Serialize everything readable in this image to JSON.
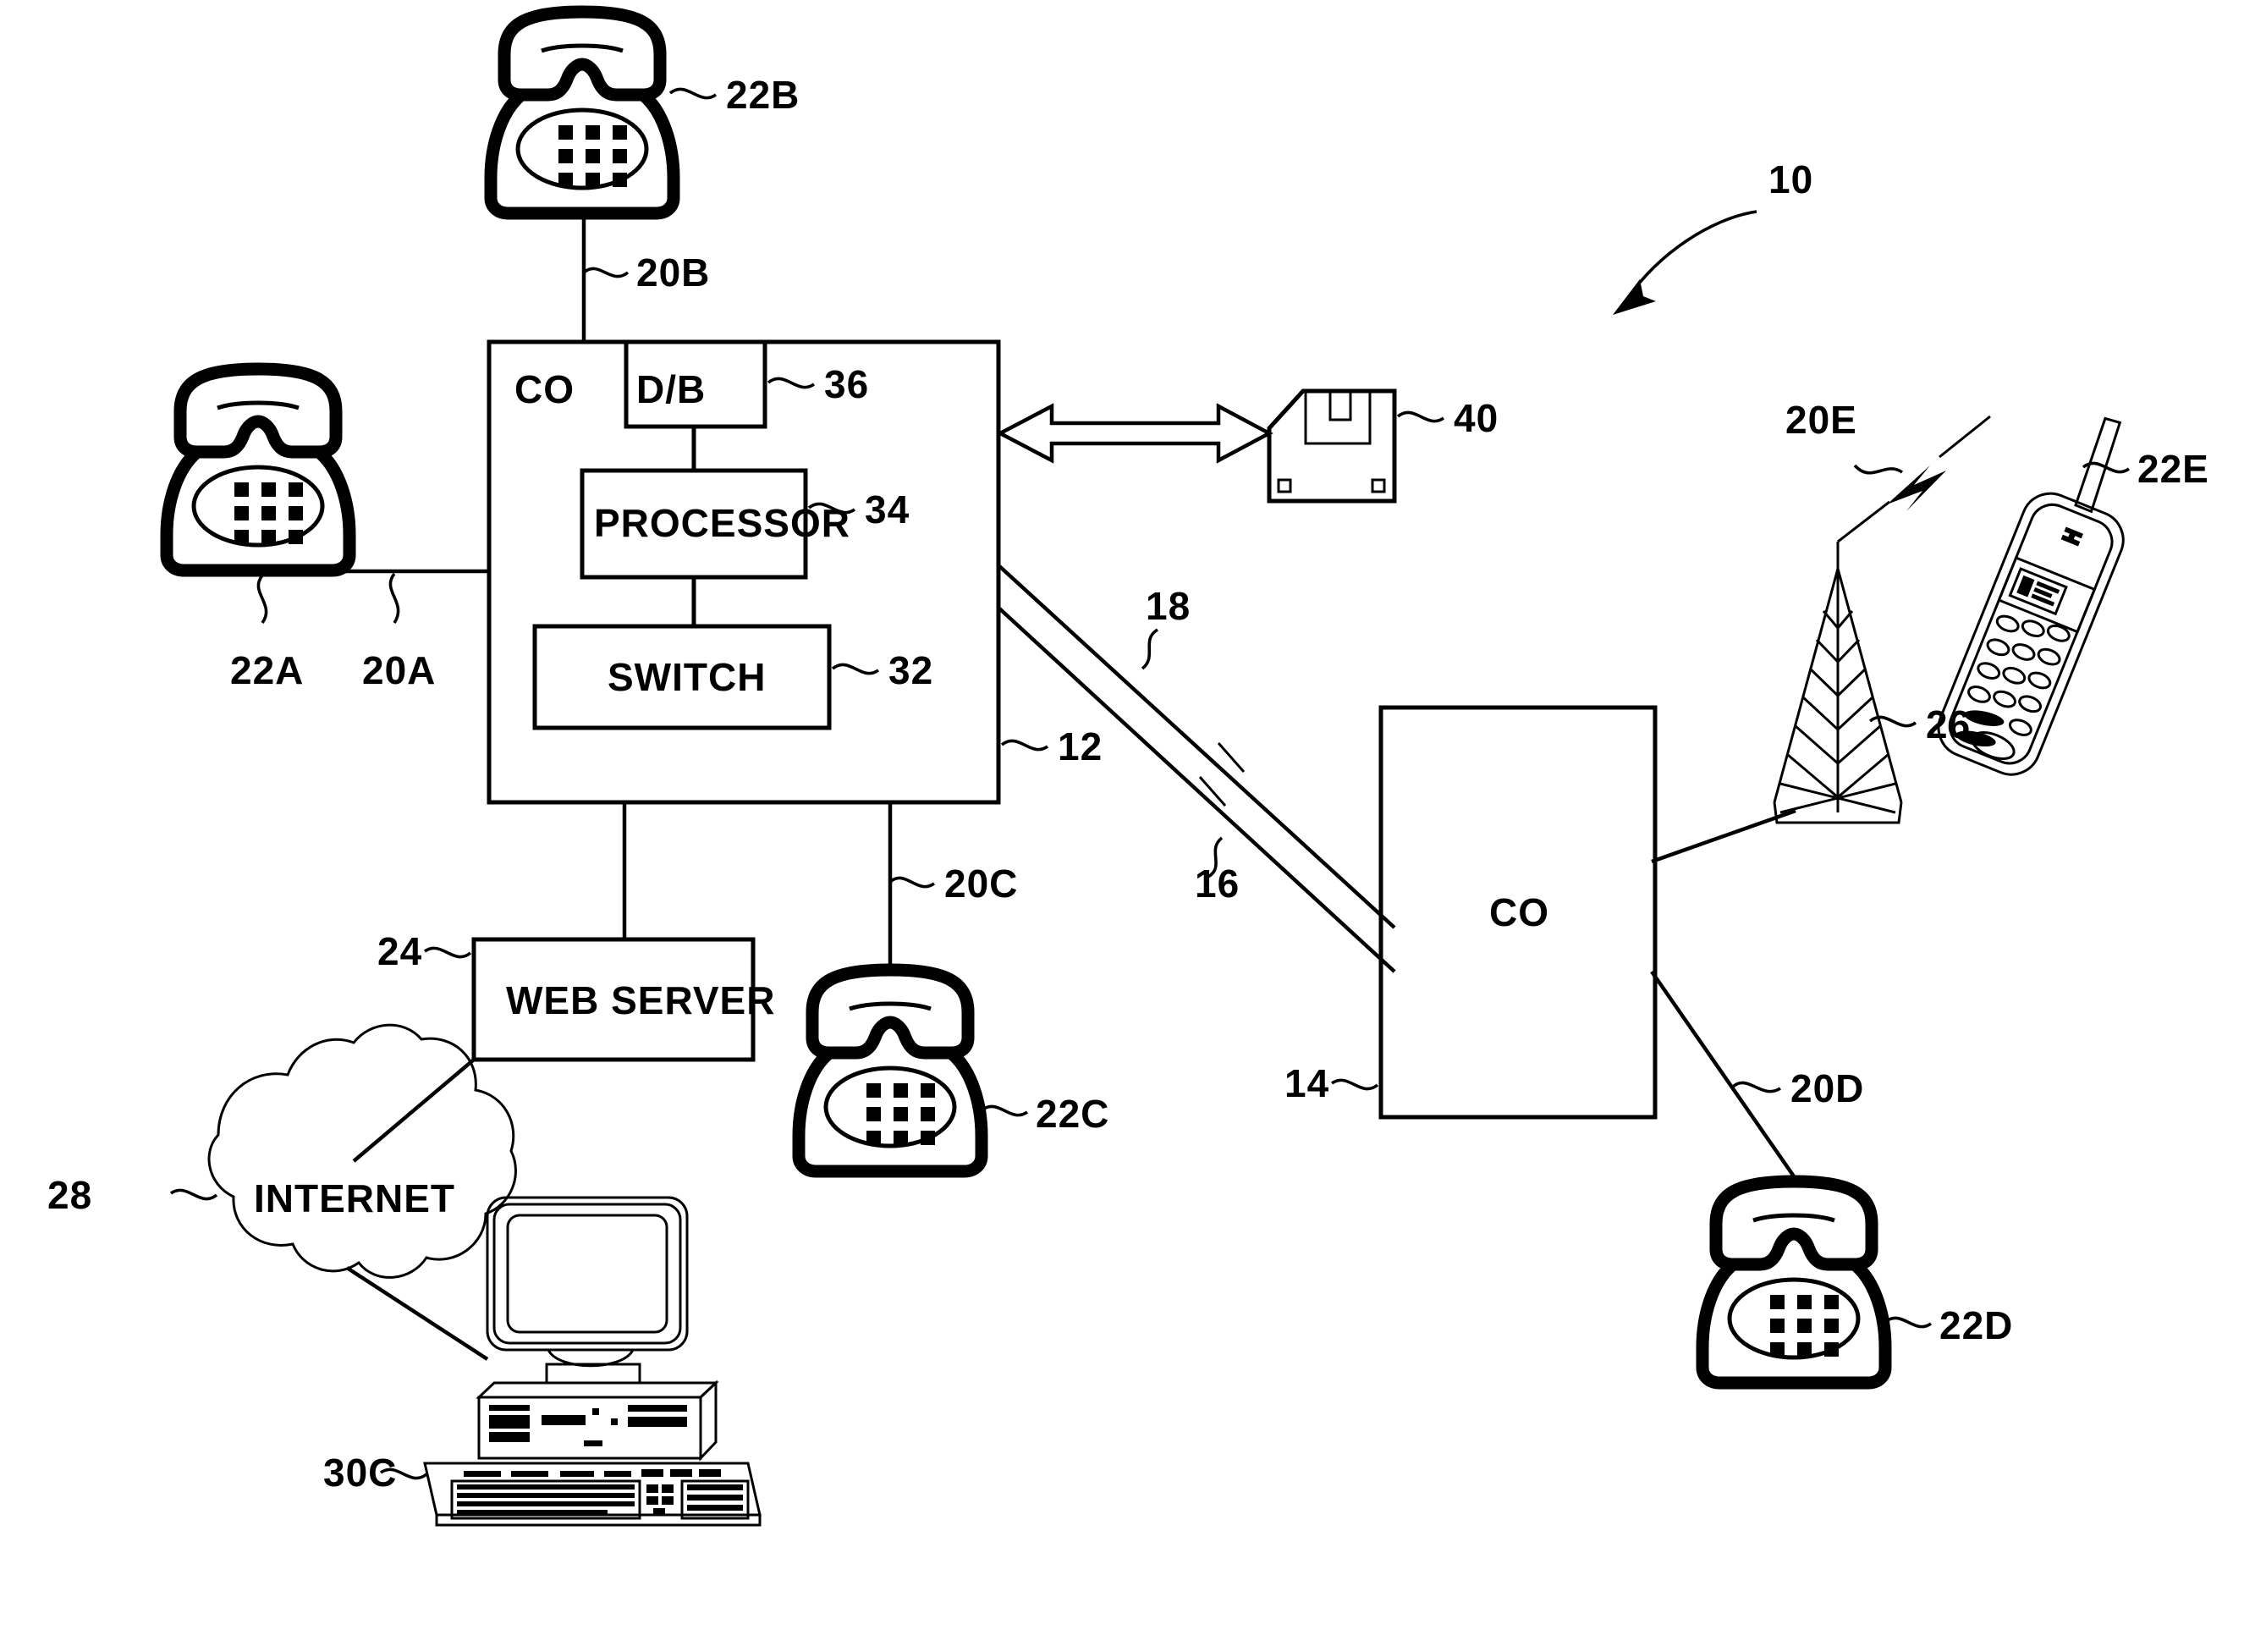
{
  "figure": {
    "domain_kind": "patent-diagram",
    "title": "Telecommunications network block diagram",
    "system_reference": "10"
  },
  "nodes": {
    "co_main": {
      "label": "CO",
      "ref": "12",
      "children": {
        "db": {
          "label": "D/B",
          "ref": "36"
        },
        "processor": {
          "label": "PROCESSOR",
          "ref": "34"
        },
        "switch": {
          "label": "SWITCH",
          "ref": "32"
        }
      }
    },
    "co_remote": {
      "label": "CO",
      "ref": "14"
    },
    "web_server": {
      "label": "WEB SERVER",
      "ref": "24"
    },
    "internet": {
      "label": "INTERNET",
      "ref": "28"
    },
    "computer": {
      "ref": "30C",
      "icon": "desktop-computer-icon"
    },
    "floppy": {
      "ref": "40",
      "icon": "floppy-disk-icon"
    },
    "tower": {
      "ref": "26",
      "icon": "cell-tower-icon"
    },
    "mobile": {
      "ref": "22E",
      "icon": "mobile-phone-icon"
    }
  },
  "telephones": [
    {
      "ref": "22A",
      "line_ref": "20A",
      "icon": "telephone-icon",
      "position": "left"
    },
    {
      "ref": "22B",
      "line_ref": "20B",
      "icon": "telephone-icon",
      "position": "top"
    },
    {
      "ref": "22C",
      "line_ref": "20C",
      "icon": "telephone-icon",
      "position": "bottom-center"
    },
    {
      "ref": "22D",
      "line_ref": "20D",
      "icon": "telephone-icon",
      "position": "bottom-right"
    }
  ],
  "trunks": [
    {
      "ref": "18",
      "desc": "upper trunk line between CO 12 and CO 14"
    },
    {
      "ref": "16",
      "desc": "lower trunk line between CO 12 and CO 14"
    }
  ],
  "wireless_link": {
    "ref": "20E",
    "icon": "lightning-bolt-icon"
  },
  "colors": {
    "ink": "#000000",
    "paper": "#ffffff"
  }
}
